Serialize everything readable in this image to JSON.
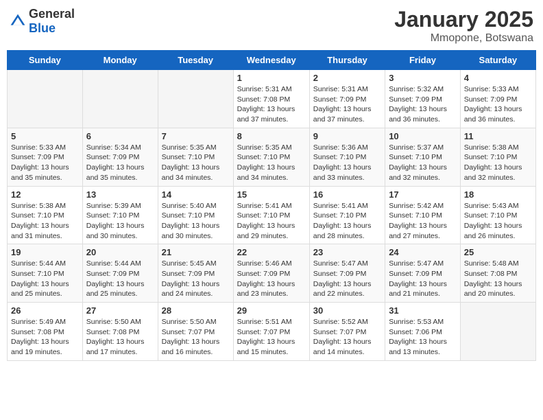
{
  "header": {
    "logo_general": "General",
    "logo_blue": "Blue",
    "month": "January 2025",
    "location": "Mmopone, Botswana"
  },
  "weekdays": [
    "Sunday",
    "Monday",
    "Tuesday",
    "Wednesday",
    "Thursday",
    "Friday",
    "Saturday"
  ],
  "weeks": [
    [
      {
        "day": "",
        "sunrise": "",
        "sunset": "",
        "daylight": ""
      },
      {
        "day": "",
        "sunrise": "",
        "sunset": "",
        "daylight": ""
      },
      {
        "day": "",
        "sunrise": "",
        "sunset": "",
        "daylight": ""
      },
      {
        "day": "1",
        "sunrise": "Sunrise: 5:31 AM",
        "sunset": "Sunset: 7:08 PM",
        "daylight": "Daylight: 13 hours and 37 minutes."
      },
      {
        "day": "2",
        "sunrise": "Sunrise: 5:31 AM",
        "sunset": "Sunset: 7:09 PM",
        "daylight": "Daylight: 13 hours and 37 minutes."
      },
      {
        "day": "3",
        "sunrise": "Sunrise: 5:32 AM",
        "sunset": "Sunset: 7:09 PM",
        "daylight": "Daylight: 13 hours and 36 minutes."
      },
      {
        "day": "4",
        "sunrise": "Sunrise: 5:33 AM",
        "sunset": "Sunset: 7:09 PM",
        "daylight": "Daylight: 13 hours and 36 minutes."
      }
    ],
    [
      {
        "day": "5",
        "sunrise": "Sunrise: 5:33 AM",
        "sunset": "Sunset: 7:09 PM",
        "daylight": "Daylight: 13 hours and 35 minutes."
      },
      {
        "day": "6",
        "sunrise": "Sunrise: 5:34 AM",
        "sunset": "Sunset: 7:09 PM",
        "daylight": "Daylight: 13 hours and 35 minutes."
      },
      {
        "day": "7",
        "sunrise": "Sunrise: 5:35 AM",
        "sunset": "Sunset: 7:10 PM",
        "daylight": "Daylight: 13 hours and 34 minutes."
      },
      {
        "day": "8",
        "sunrise": "Sunrise: 5:35 AM",
        "sunset": "Sunset: 7:10 PM",
        "daylight": "Daylight: 13 hours and 34 minutes."
      },
      {
        "day": "9",
        "sunrise": "Sunrise: 5:36 AM",
        "sunset": "Sunset: 7:10 PM",
        "daylight": "Daylight: 13 hours and 33 minutes."
      },
      {
        "day": "10",
        "sunrise": "Sunrise: 5:37 AM",
        "sunset": "Sunset: 7:10 PM",
        "daylight": "Daylight: 13 hours and 32 minutes."
      },
      {
        "day": "11",
        "sunrise": "Sunrise: 5:38 AM",
        "sunset": "Sunset: 7:10 PM",
        "daylight": "Daylight: 13 hours and 32 minutes."
      }
    ],
    [
      {
        "day": "12",
        "sunrise": "Sunrise: 5:38 AM",
        "sunset": "Sunset: 7:10 PM",
        "daylight": "Daylight: 13 hours and 31 minutes."
      },
      {
        "day": "13",
        "sunrise": "Sunrise: 5:39 AM",
        "sunset": "Sunset: 7:10 PM",
        "daylight": "Daylight: 13 hours and 30 minutes."
      },
      {
        "day": "14",
        "sunrise": "Sunrise: 5:40 AM",
        "sunset": "Sunset: 7:10 PM",
        "daylight": "Daylight: 13 hours and 30 minutes."
      },
      {
        "day": "15",
        "sunrise": "Sunrise: 5:41 AM",
        "sunset": "Sunset: 7:10 PM",
        "daylight": "Daylight: 13 hours and 29 minutes."
      },
      {
        "day": "16",
        "sunrise": "Sunrise: 5:41 AM",
        "sunset": "Sunset: 7:10 PM",
        "daylight": "Daylight: 13 hours and 28 minutes."
      },
      {
        "day": "17",
        "sunrise": "Sunrise: 5:42 AM",
        "sunset": "Sunset: 7:10 PM",
        "daylight": "Daylight: 13 hours and 27 minutes."
      },
      {
        "day": "18",
        "sunrise": "Sunrise: 5:43 AM",
        "sunset": "Sunset: 7:10 PM",
        "daylight": "Daylight: 13 hours and 26 minutes."
      }
    ],
    [
      {
        "day": "19",
        "sunrise": "Sunrise: 5:44 AM",
        "sunset": "Sunset: 7:10 PM",
        "daylight": "Daylight: 13 hours and 25 minutes."
      },
      {
        "day": "20",
        "sunrise": "Sunrise: 5:44 AM",
        "sunset": "Sunset: 7:09 PM",
        "daylight": "Daylight: 13 hours and 25 minutes."
      },
      {
        "day": "21",
        "sunrise": "Sunrise: 5:45 AM",
        "sunset": "Sunset: 7:09 PM",
        "daylight": "Daylight: 13 hours and 24 minutes."
      },
      {
        "day": "22",
        "sunrise": "Sunrise: 5:46 AM",
        "sunset": "Sunset: 7:09 PM",
        "daylight": "Daylight: 13 hours and 23 minutes."
      },
      {
        "day": "23",
        "sunrise": "Sunrise: 5:47 AM",
        "sunset": "Sunset: 7:09 PM",
        "daylight": "Daylight: 13 hours and 22 minutes."
      },
      {
        "day": "24",
        "sunrise": "Sunrise: 5:47 AM",
        "sunset": "Sunset: 7:09 PM",
        "daylight": "Daylight: 13 hours and 21 minutes."
      },
      {
        "day": "25",
        "sunrise": "Sunrise: 5:48 AM",
        "sunset": "Sunset: 7:08 PM",
        "daylight": "Daylight: 13 hours and 20 minutes."
      }
    ],
    [
      {
        "day": "26",
        "sunrise": "Sunrise: 5:49 AM",
        "sunset": "Sunset: 7:08 PM",
        "daylight": "Daylight: 13 hours and 19 minutes."
      },
      {
        "day": "27",
        "sunrise": "Sunrise: 5:50 AM",
        "sunset": "Sunset: 7:08 PM",
        "daylight": "Daylight: 13 hours and 17 minutes."
      },
      {
        "day": "28",
        "sunrise": "Sunrise: 5:50 AM",
        "sunset": "Sunset: 7:07 PM",
        "daylight": "Daylight: 13 hours and 16 minutes."
      },
      {
        "day": "29",
        "sunrise": "Sunrise: 5:51 AM",
        "sunset": "Sunset: 7:07 PM",
        "daylight": "Daylight: 13 hours and 15 minutes."
      },
      {
        "day": "30",
        "sunrise": "Sunrise: 5:52 AM",
        "sunset": "Sunset: 7:07 PM",
        "daylight": "Daylight: 13 hours and 14 minutes."
      },
      {
        "day": "31",
        "sunrise": "Sunrise: 5:53 AM",
        "sunset": "Sunset: 7:06 PM",
        "daylight": "Daylight: 13 hours and 13 minutes."
      },
      {
        "day": "",
        "sunrise": "",
        "sunset": "",
        "daylight": ""
      }
    ]
  ]
}
